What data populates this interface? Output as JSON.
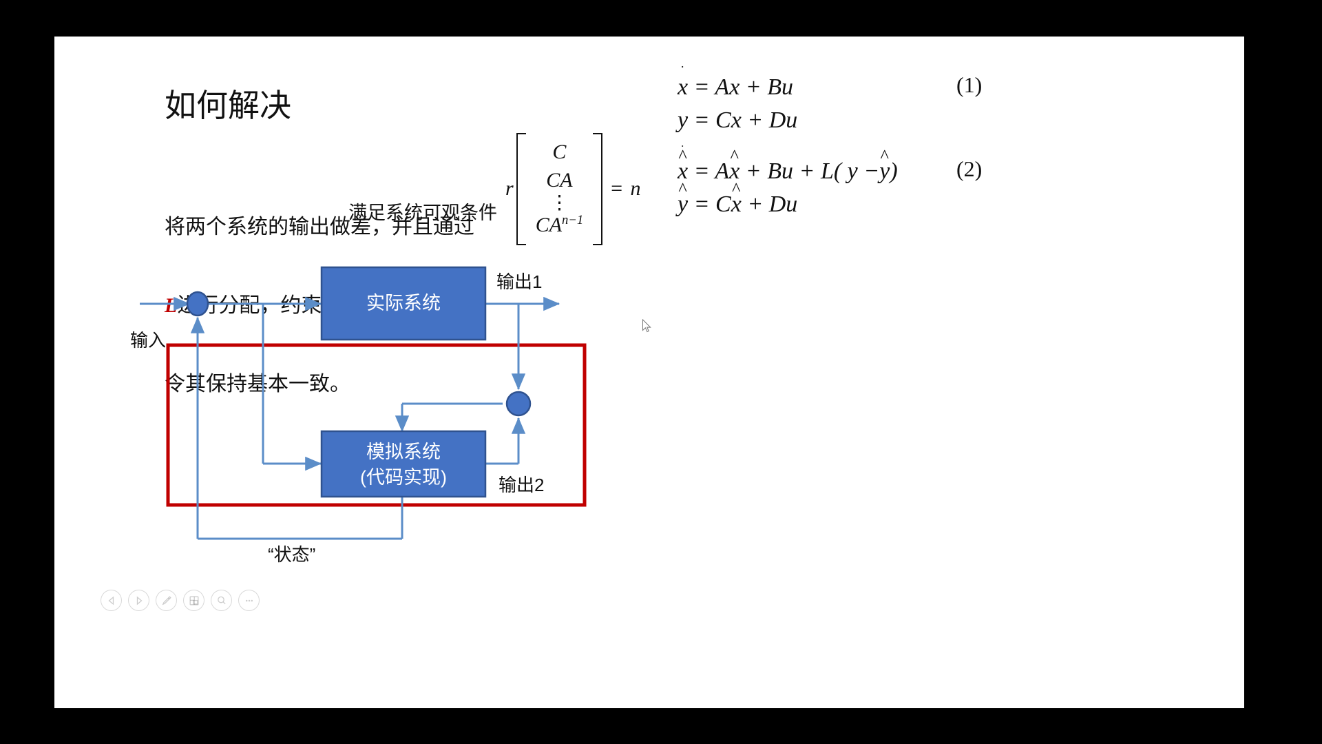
{
  "slide": {
    "title": "如何解决",
    "paragraph_lines": [
      {
        "pre": "将两个系统的输出做差，并且通过",
        "hl": "",
        "post": ""
      },
      {
        "pre": "",
        "hl": "L",
        "post": "进行分配，约束两个系统的状态"
      },
      {
        "pre": "令其保持基本一致。",
        "hl": "",
        "post": ""
      }
    ],
    "observability_caption": "满足系统可观条件"
  },
  "rank_matrix": {
    "rank_symbol": "r",
    "rows": [
      "C",
      "CA",
      "⋮",
      "CA"
    ],
    "last_row_base": "CA",
    "last_row_exponent": "n−1",
    "vdots": "⋮",
    "equals": "=",
    "rhs": "n"
  },
  "equations": {
    "group1": {
      "number": "(1)",
      "line1": {
        "lhs_base": "x",
        "lhs_dot": "˙",
        "rhs": "= Ax + Bu"
      },
      "line2": {
        "lhs": "y",
        "rhs": "= Cx + Du"
      }
    },
    "group2": {
      "number": "(2)",
      "line1": {
        "lhs_base": "x",
        "rhs_a": "= A",
        "hat_x": "x",
        "rhs_b": "+ Bu + L( y −",
        "hat_y": "y",
        "rhs_c": ")"
      },
      "line2": {
        "hat_y": "y",
        "rhs_a": "= C",
        "hat_x": "x",
        "rhs_b": "+ Du"
      }
    }
  },
  "diagram": {
    "blocks": [
      {
        "id": "plant",
        "line1": "实际系统",
        "line2": ""
      },
      {
        "id": "model",
        "line1": "模拟系统",
        "line2": "(代码实现)"
      }
    ],
    "labels": {
      "input": "输入",
      "output1": "输出1",
      "output2": "输出2",
      "state": "“状态”"
    },
    "colors": {
      "block_fill": "#4472C4",
      "block_stroke": "#2F528F",
      "arrow": "#5B8DC8",
      "junction_fill": "#4472C4",
      "junction_stroke": "#2F528F",
      "highlight_box": "#C00000"
    }
  },
  "toolbar": {
    "buttons": [
      {
        "name": "previous-slide",
        "icon": "triangle-left-icon"
      },
      {
        "name": "next-slide",
        "icon": "triangle-right-icon"
      },
      {
        "name": "pen-tool",
        "icon": "pen-icon"
      },
      {
        "name": "slide-overview",
        "icon": "grid-icon"
      },
      {
        "name": "zoom-tool",
        "icon": "magnifier-icon"
      },
      {
        "name": "more-options",
        "icon": "ellipsis-icon"
      }
    ]
  }
}
